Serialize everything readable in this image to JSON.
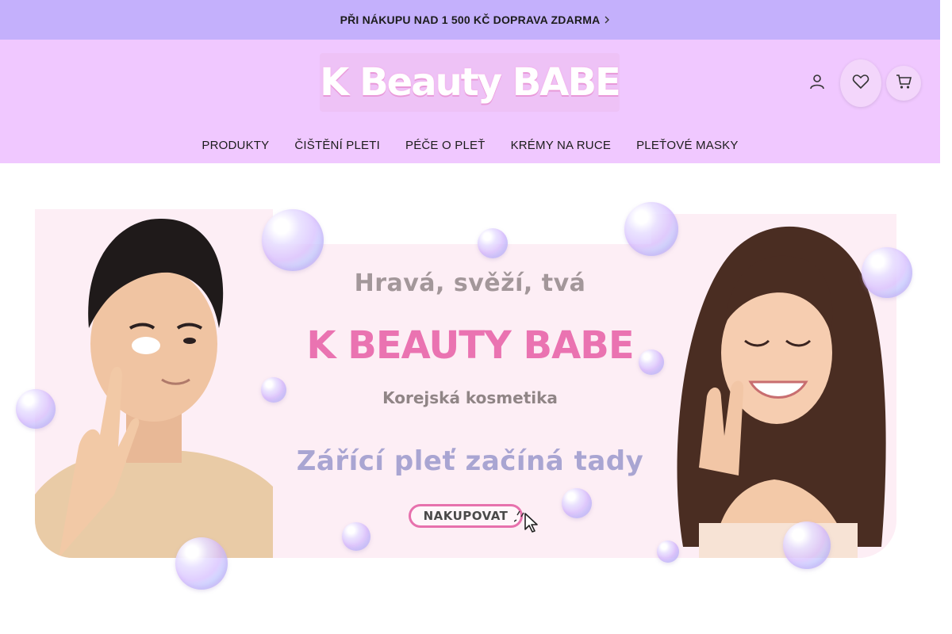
{
  "announcement": {
    "text": "PŘI NÁKUPU NAD 1 500 KČ DOPRAVA ZDARMA",
    "icon": "chevron-right-icon"
  },
  "header": {
    "logo_text": "K Beauty BABE",
    "icons": [
      "user-icon",
      "heart-icon",
      "cart-icon"
    ]
  },
  "nav": {
    "items": [
      {
        "label": "PRODUKTY"
      },
      {
        "label": "ČIŠTĚNÍ PLETI"
      },
      {
        "label": "PÉČE O PLEŤ"
      },
      {
        "label": "KRÉMY NA RUCE"
      },
      {
        "label": "PLEŤOVÉ MASKY"
      }
    ]
  },
  "hero": {
    "title1": "Hravá, svěží, tvá",
    "title2": "K BEAUTY BABE",
    "subtitle": "Korejská kosmetika",
    "tagline": "Zářící pleť začíná tady",
    "cta_label": "NAKUPOVAT"
  },
  "colors": {
    "announcement_bg": "#c4b0fc",
    "header_bg": "#f0c8ff",
    "hero_card_bg": "#fdeef5",
    "accent_pink": "#ea73b1",
    "tagline_lavender": "#a9a5d2"
  }
}
